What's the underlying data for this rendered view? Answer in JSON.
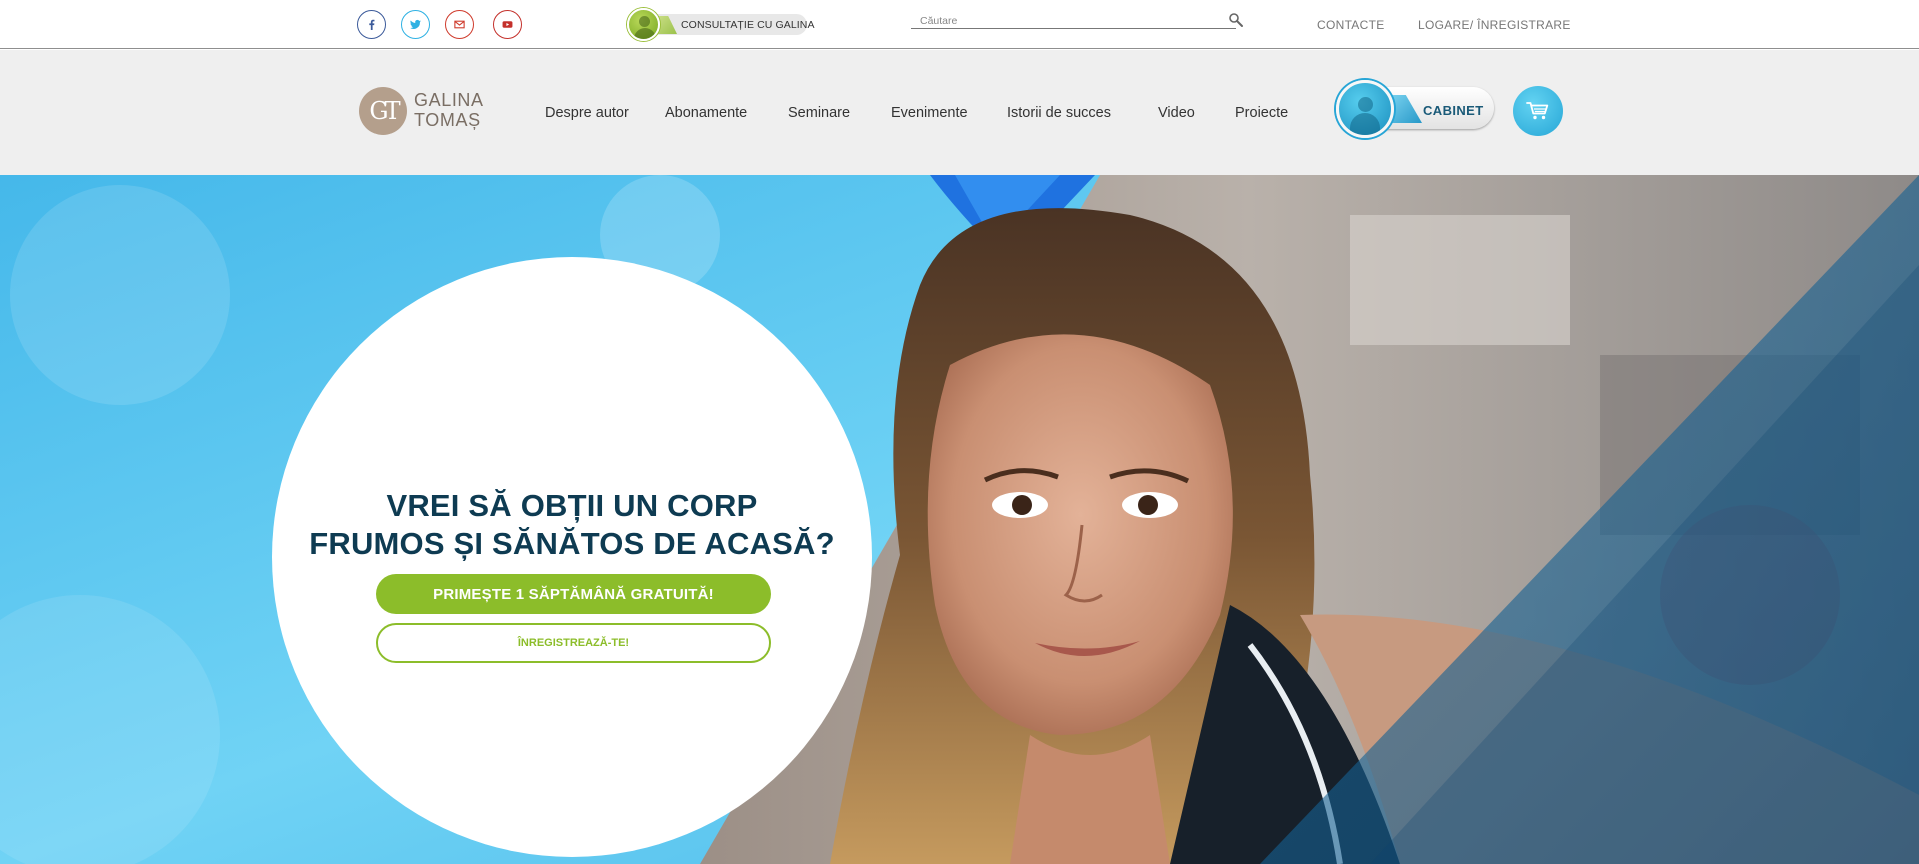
{
  "topbar": {
    "social": [
      {
        "name": "facebook-icon",
        "color": "#3b5a9a"
      },
      {
        "name": "twitter-icon",
        "color": "#2eb1e3"
      },
      {
        "name": "gmail-icon",
        "color": "#cf3b2c"
      },
      {
        "name": "youtube-icon",
        "color": "#c4302b"
      }
    ],
    "consult_label": "CONSULTAȚIE CU GALINA",
    "search_placeholder": "Căutare",
    "contacte": "CONTACTE",
    "login": "LOGARE/ ÎNREGISTRARE"
  },
  "logo": {
    "monogram": "GT",
    "line1": "GALINA",
    "line2": "TOMAȘ"
  },
  "nav": {
    "items": [
      "Despre autor",
      "Abonamente",
      "Seminare",
      "Evenimente",
      "Istorii de succes",
      "Video",
      "Proiecte"
    ],
    "cabinet": "CABINET"
  },
  "hero": {
    "headline_line1": "VREI SĂ OBȚII UN CORP",
    "headline_line2": "FRUMOS ȘI SĂNĂTOS DE ACASĂ?",
    "cta_primary": "PRIMEȘTE 1 SĂPTĂMÂNĂ GRATUITĂ!",
    "cta_secondary": "ÎNREGISTREAZĂ-TE!"
  },
  "colors": {
    "accent_green": "#8cbd2a",
    "accent_blue": "#26a6d6",
    "headline_navy": "#0e3b52",
    "logo_taupe": "#b49f8c"
  }
}
